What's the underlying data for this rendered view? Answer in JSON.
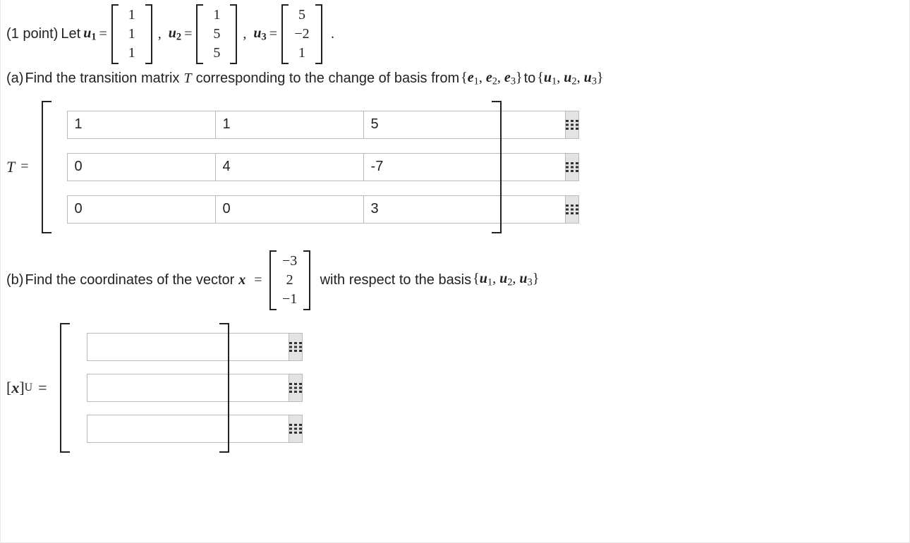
{
  "problem": {
    "points_label": "(1 point) ",
    "let_text": "Let ",
    "period": ".",
    "comma": ",",
    "equals": " = ",
    "u_symbol": "u",
    "e_symbol": "e",
    "x_symbol": "x",
    "T_symbol": "T",
    "U_symbol": "U"
  },
  "vectors": {
    "u1": [
      "1",
      "1",
      "1"
    ],
    "u2": [
      "1",
      "5",
      "5"
    ],
    "u3": [
      "5",
      "−2",
      "1"
    ],
    "x": [
      "−3",
      "2",
      "−1"
    ]
  },
  "parts": {
    "a": {
      "label": "(a)",
      "text1": " Find the transition matrix ",
      "text2": " corresponding to the change of basis from ",
      "text3": " to "
    },
    "b": {
      "label": "(b)",
      "text1": " Find the coordinates of the vector ",
      "text2": " with respect to the basis "
    }
  },
  "answers": {
    "T": [
      [
        "1",
        "1",
        "5"
      ],
      [
        "0",
        "4",
        "-7"
      ],
      [
        "0",
        "0",
        "3"
      ]
    ],
    "xU": [
      "",
      "",
      ""
    ]
  },
  "lhs": {
    "T": "T",
    "xU": "[x]_U"
  }
}
